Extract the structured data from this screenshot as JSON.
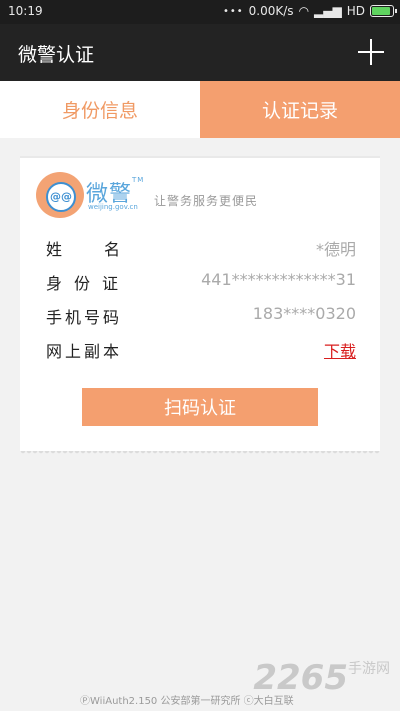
{
  "status_bar": {
    "time": "10:19",
    "network": "0.00K/s",
    "signal_label": "HD"
  },
  "app_bar": {
    "title": "微警认证",
    "add_icon": "plus-icon"
  },
  "tabs": [
    {
      "label": "身份信息",
      "active": false,
      "color": "#f09a64"
    },
    {
      "label": "认证记录",
      "active": true,
      "color": "#f49f6f"
    }
  ],
  "card": {
    "logo_text": "@@",
    "brand_name": "微警",
    "brand_tm": "TM",
    "brand_url": "weijing.gov.cn",
    "slogan": "让警务服务更便民",
    "fields": [
      {
        "label": "姓名",
        "value": "*德明"
      },
      {
        "label": "身份证",
        "value": "441*************31"
      },
      {
        "label": "手机号码",
        "value": "183****0320"
      },
      {
        "label": "网上副本",
        "value": "下载"
      }
    ],
    "scan_button": "扫码认证"
  },
  "footer": {
    "text": "ⓅWiiAuth2.150  公安部第一研究所  ⓒ大白互联"
  },
  "watermark": {
    "main": "2265",
    "sub": "手游网"
  },
  "colors": {
    "accent": "#f49f6f",
    "link": "#d81e1e",
    "header": "#232323"
  }
}
